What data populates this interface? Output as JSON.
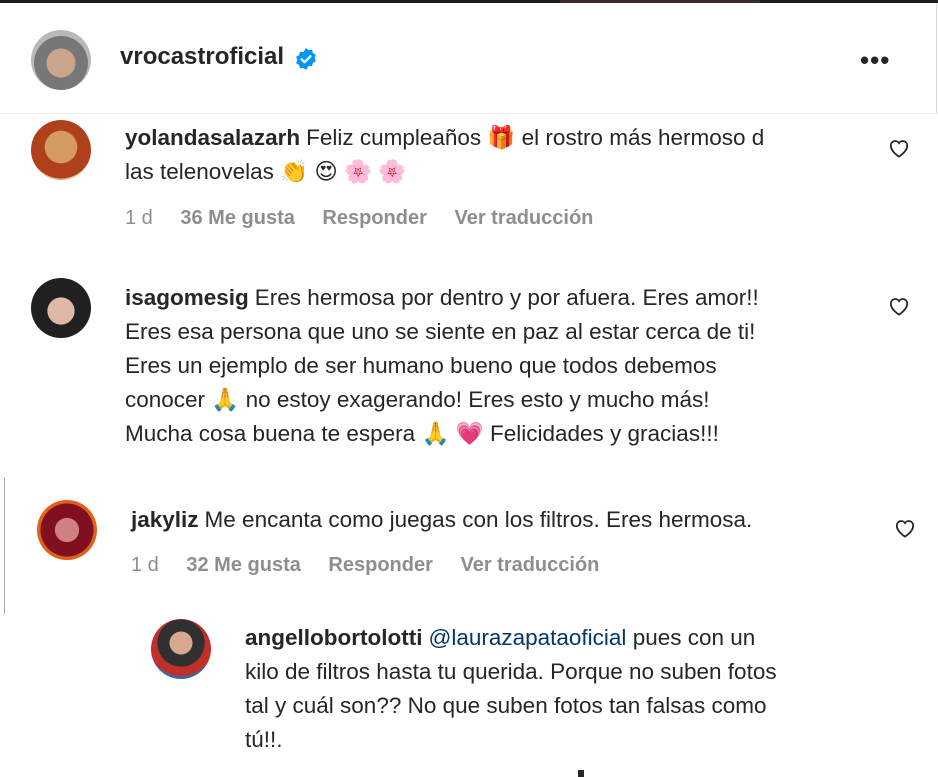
{
  "header": {
    "username": "vrocastroficial",
    "more_label": "•••"
  },
  "comments": [
    {
      "user": "yolandasalazarh",
      "lines": [
        "Feliz cumpleaños 🎁 el rostro más hermoso d",
        "las telenovelas 👏 😍 🌸 🌸"
      ],
      "time": "1 d",
      "likes": "36 Me gusta",
      "reply": "Responder",
      "translate": "Ver traducción"
    },
    {
      "user": "isagomesig",
      "lines": [
        "Eres hermosa por dentro y por afuera. Eres amor!!",
        "Eres esa persona que uno se siente en paz al estar cerca de ti!",
        "Eres un ejemplo de ser humano bueno que todos debemos",
        "conocer 🙏 no estoy exagerando! Eres esto y mucho más!",
        "Mucha cosa buena te espera 🙏 💗 Felicidades y gracias!!!"
      ]
    },
    {
      "user": "jakyliz",
      "lines": [
        "Me encanta como juegas con los filtros. Eres hermosa."
      ],
      "time": "1 d",
      "likes": "32 Me gusta",
      "reply": "Responder",
      "translate": "Ver traducción"
    },
    {
      "user": "angellobortolotti",
      "mention": "@laurazapataoficial",
      "lines": [
        "pues con un",
        "kilo de filtros hasta tu querida. Porque no suben fotos",
        "tal y cuál son?? No que suben fotos tan falsas como",
        "tú!!."
      ]
    }
  ]
}
